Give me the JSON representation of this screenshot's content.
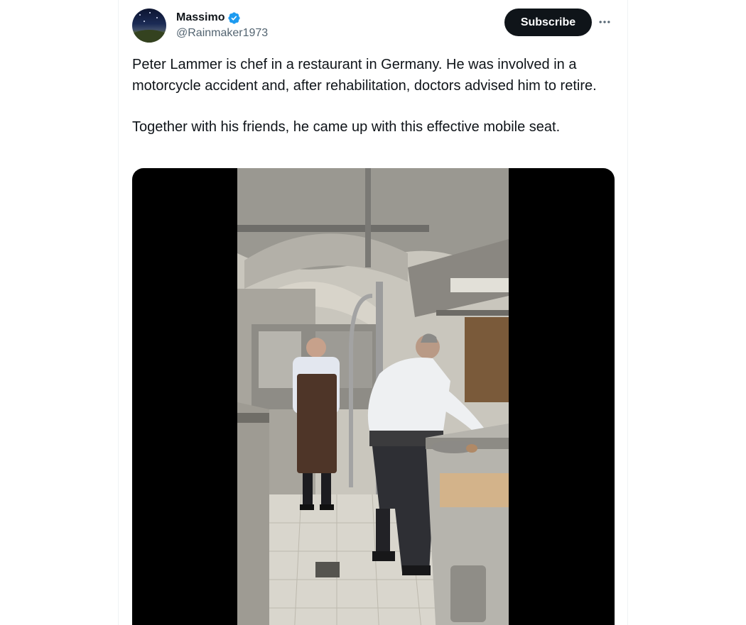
{
  "post": {
    "author": {
      "display_name": "Massimo",
      "handle": "@Rainmaker1973",
      "verified": true,
      "avatar_icon": "night-sky-avatar"
    },
    "subscribe_label": "Subscribe",
    "more_icon": "more-options-icon",
    "text_paragraphs": [
      "Peter Lammer is chef in a restaurant in Germany. He was involved in a motorcycle accident and, after rehabilitation, doctors advised him to retire.",
      "Together with his friends, he came up with this effective mobile seat."
    ],
    "media": {
      "type": "video",
      "scene": "restaurant-kitchen-video-frame"
    }
  },
  "colors": {
    "text_primary": "#0f1419",
    "text_secondary": "#536471",
    "verified_blue": "#1d9bf0",
    "button_bg": "#0f1419",
    "media_letterbox": "#000000"
  }
}
